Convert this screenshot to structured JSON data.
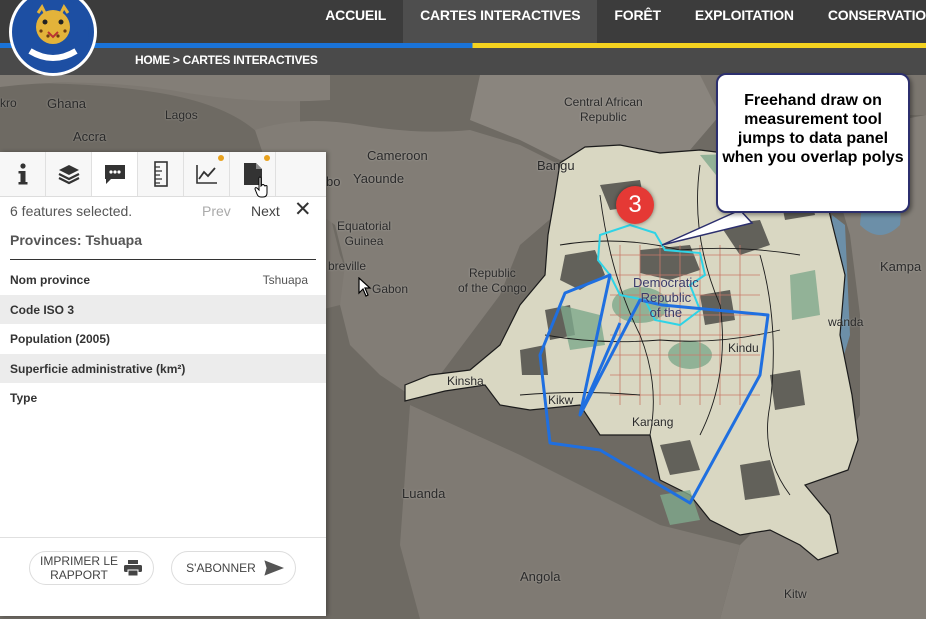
{
  "header": {
    "nav": [
      "ACCUEIL",
      "CARTES INTERACTIVES",
      "FORÊT",
      "EXPLOITATION",
      "CONSERVATIO"
    ],
    "active_nav": "CARTES INTERACTIVES",
    "breadcrumb": "HOME > CARTES INTERACTIVES"
  },
  "map": {
    "labels": {
      "ghana": "Ghana",
      "lagos": "Lagos",
      "accra": "Accra",
      "kro": "kro",
      "car": "Central African\nRepublic",
      "bangui": "Bangu",
      "cameroon": "Cameroon",
      "yaounde": "Yaounde",
      "bo": "bo",
      "eq_guinea": "Equatorial\nGuinea",
      "libreville": "breville",
      "gabon": "Gabon",
      "congo": "Republic\nof the Congo",
      "drc": "Democratic\nRepublic\nof the",
      "kinshasa": "Kinsha",
      "kikwit": "Kikw",
      "kananga": "Kanang",
      "kindu": "Kindu",
      "kampala": "Kampa",
      "rwanda": "wanda",
      "luanda": "Luanda",
      "angola": "Angola",
      "kitwe": "Kitw"
    },
    "callout_text": "Freehand draw on measurement tool jumps to data panel when you overlap polys",
    "step_number": "3"
  },
  "panel": {
    "tabs": [
      "info-icon",
      "layers-icon",
      "comment-icon",
      "ruler-icon",
      "chart-icon",
      "document-icon"
    ],
    "active_tab": "comment-icon",
    "selection_text": "6 features selected.",
    "prev_label": "Prev",
    "next_label": "Next",
    "close_label": "✕",
    "feature_title": "Provinces: Tshuapa",
    "attributes": [
      {
        "key": "Nom province",
        "value": "Tshuapa"
      },
      {
        "key": "Code ISO 3",
        "value": ""
      },
      {
        "key": "Population (2005)",
        "value": ""
      },
      {
        "key": "Superficie administrative (km²)",
        "value": ""
      },
      {
        "key": "Type",
        "value": ""
      }
    ],
    "print_label": "IMPRIMER LE\nRAPPORT",
    "subscribe_label": "S'ABONNER"
  },
  "colors": {
    "header_bg": "#3c3c3c",
    "flag_blue": "#1a73d8",
    "flag_yellow": "#f4d21f",
    "measure_line": "#1f6fe0",
    "selected_poly": "#2fd3e6",
    "badge": "#e53935",
    "callout_border": "#2c2f6e"
  }
}
